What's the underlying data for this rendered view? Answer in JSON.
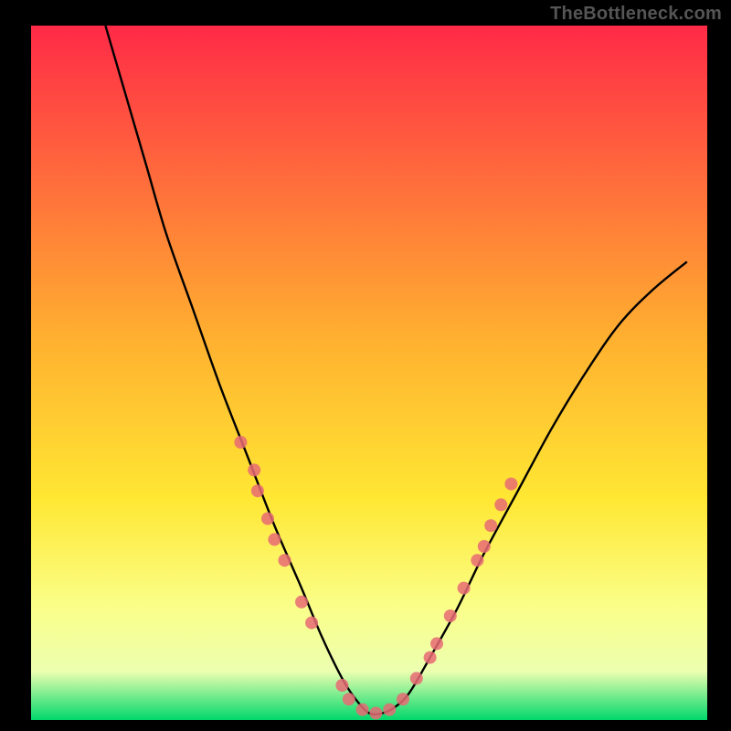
{
  "watermark": "TheBottleneck.com",
  "chart_data": {
    "type": "line",
    "title": "",
    "xlabel": "",
    "ylabel": "",
    "xlim": [
      0,
      100
    ],
    "ylim": [
      0,
      100
    ],
    "gradient_colors": {
      "top": "#ff2a47",
      "mid1": "#ffb030",
      "mid2": "#ffe733",
      "mid3": "#faff8a",
      "low": "#ecffb0",
      "base": "#00d86b"
    },
    "curve": {
      "name": "bottleneck-curve",
      "x": [
        11,
        14,
        17,
        20,
        24,
        28,
        32,
        36,
        40,
        43,
        46,
        48,
        50,
        52,
        54,
        56,
        59,
        63,
        67,
        72,
        77,
        82,
        87,
        92,
        97
      ],
      "y": [
        100,
        90,
        80,
        70,
        59,
        48,
        38,
        28,
        19,
        12,
        6,
        3,
        1,
        1,
        2,
        4,
        9,
        16,
        24,
        33,
        42,
        50,
        57,
        62,
        66
      ]
    },
    "markers": {
      "name": "highlight-points",
      "color": "#e76a74",
      "radius": 7,
      "points": [
        {
          "x": 31,
          "y": 40
        },
        {
          "x": 33,
          "y": 36
        },
        {
          "x": 33.5,
          "y": 33
        },
        {
          "x": 35,
          "y": 29
        },
        {
          "x": 36,
          "y": 26
        },
        {
          "x": 37.5,
          "y": 23
        },
        {
          "x": 40,
          "y": 17
        },
        {
          "x": 41.5,
          "y": 14
        },
        {
          "x": 46,
          "y": 5
        },
        {
          "x": 47,
          "y": 3
        },
        {
          "x": 49,
          "y": 1.5
        },
        {
          "x": 51,
          "y": 1
        },
        {
          "x": 53,
          "y": 1.5
        },
        {
          "x": 55,
          "y": 3
        },
        {
          "x": 57,
          "y": 6
        },
        {
          "x": 59,
          "y": 9
        },
        {
          "x": 60,
          "y": 11
        },
        {
          "x": 62,
          "y": 15
        },
        {
          "x": 64,
          "y": 19
        },
        {
          "x": 66,
          "y": 23
        },
        {
          "x": 67,
          "y": 25
        },
        {
          "x": 68,
          "y": 28
        },
        {
          "x": 69.5,
          "y": 31
        },
        {
          "x": 71,
          "y": 34
        }
      ]
    }
  }
}
